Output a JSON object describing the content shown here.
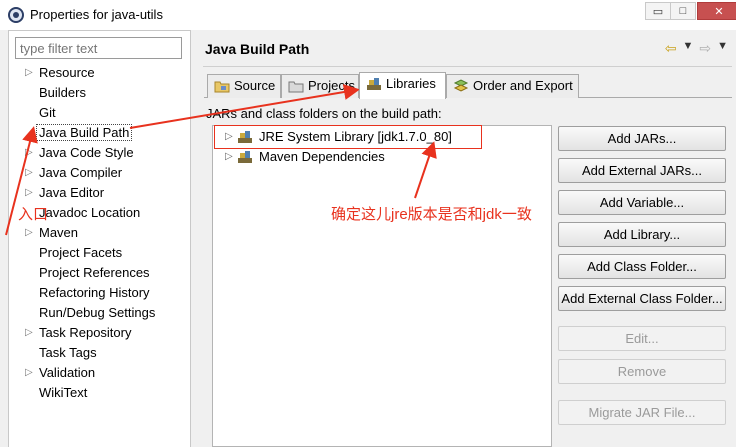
{
  "window": {
    "title": "Properties for java-utils",
    "minimize_glyph": "▭",
    "maximize_glyph": "□",
    "close_glyph": "✕"
  },
  "filter": {
    "placeholder": "type filter text",
    "value": ""
  },
  "nav": [
    {
      "label": "Resource",
      "expandable": true
    },
    {
      "label": "Builders",
      "expandable": false
    },
    {
      "label": "Git",
      "expandable": false
    },
    {
      "label": "Java Build Path",
      "expandable": false,
      "selected": true
    },
    {
      "label": "Java Code Style",
      "expandable": true
    },
    {
      "label": "Java Compiler",
      "expandable": true
    },
    {
      "label": "Java Editor",
      "expandable": true
    },
    {
      "label": "Javadoc Location",
      "expandable": false
    },
    {
      "label": "Maven",
      "expandable": true
    },
    {
      "label": "Project Facets",
      "expandable": false
    },
    {
      "label": "Project References",
      "expandable": false
    },
    {
      "label": "Refactoring History",
      "expandable": false
    },
    {
      "label": "Run/Debug Settings",
      "expandable": false
    },
    {
      "label": "Task Repository",
      "expandable": true
    },
    {
      "label": "Task Tags",
      "expandable": false
    },
    {
      "label": "Validation",
      "expandable": true
    },
    {
      "label": "WikiText",
      "expandable": false
    }
  ],
  "page": {
    "title": "Java Build Path",
    "tabs": [
      {
        "label": "Source",
        "icon": "folder-icon"
      },
      {
        "label": "Projects",
        "icon": "project-icon"
      },
      {
        "label": "Libraries",
        "icon": "library-icon",
        "active": true
      },
      {
        "label": "Order and Export",
        "icon": "order-icon"
      }
    ],
    "content_label": "JARs and class folders on the build path:",
    "libraries": [
      {
        "label": "JRE System Library [jdk1.7.0_80]",
        "icon": "library-icon"
      },
      {
        "label": "Maven Dependencies",
        "icon": "library-icon"
      }
    ],
    "buttons": [
      {
        "label": "Add JARs...",
        "enabled": true
      },
      {
        "label": "Add External JARs...",
        "enabled": true
      },
      {
        "label": "Add Variable...",
        "enabled": true
      },
      {
        "label": "Add Library...",
        "enabled": true
      },
      {
        "label": "Add Class Folder...",
        "enabled": true
      },
      {
        "label": "Add External Class Folder...",
        "enabled": true
      },
      {
        "label": "Edit...",
        "enabled": false
      },
      {
        "label": "Remove",
        "enabled": false
      },
      {
        "label": "Migrate JAR File...",
        "enabled": false
      }
    ]
  },
  "annotations": {
    "entry_label": "入口",
    "confirm_label": "确定这儿jre版本是否和jdk一致",
    "color": "#e8321e"
  }
}
